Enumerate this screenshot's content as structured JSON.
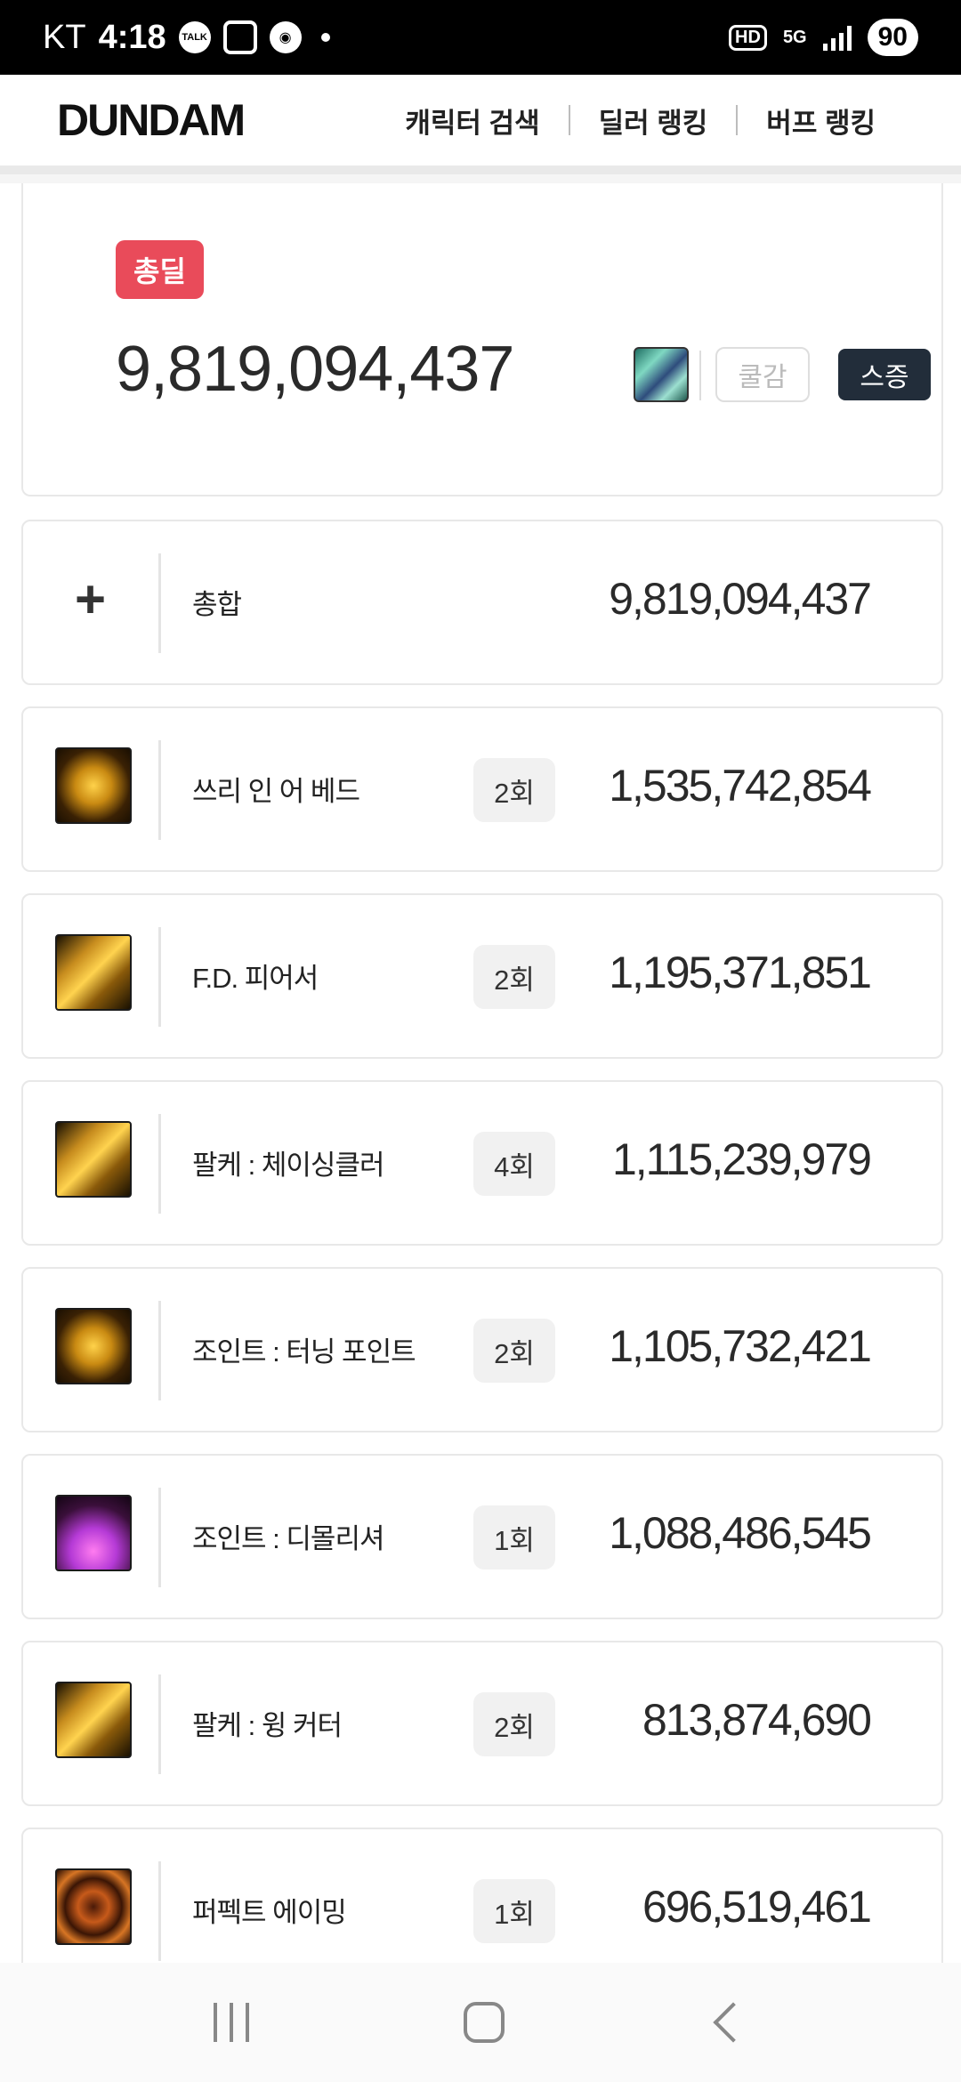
{
  "status_bar": {
    "carrier": "KT",
    "time": "4:18",
    "icon_talk": "TALK",
    "icon_2": "앱",
    "network": "5G",
    "hd": "HD",
    "battery": "90"
  },
  "header": {
    "logo": "DUNDAM",
    "nav": [
      "캐릭터 검색",
      "딜러 랭킹",
      "버프 랭킹"
    ]
  },
  "total_card": {
    "badge": "총딜",
    "value": "9,819,094,437",
    "cooldown_button": "쿨감",
    "stack_button": "스증",
    "colors": {
      "badge": "#e94b5a",
      "stack_button": "#222d3a"
    }
  },
  "summary_row": {
    "icon": "plus-icon",
    "label": "총합",
    "value": "9,819,094,437"
  },
  "skills": [
    {
      "name": "쓰리 인 어 베드",
      "count": "2회",
      "damage": "1,535,742,854",
      "icon": "three-in-a-bed-icon"
    },
    {
      "name": "F.D. 피어서",
      "count": "2회",
      "damage": "1,195,371,851",
      "icon": "fd-piercer-icon"
    },
    {
      "name": "팔케 : 체이싱클러",
      "count": "4회",
      "damage": "1,115,239,979",
      "icon": "chasing-icon"
    },
    {
      "name": "조인트 : 터닝 포인트",
      "count": "2회",
      "damage": "1,105,732,421",
      "icon": "turning-point-icon"
    },
    {
      "name": "조인트 : 디몰리셔",
      "count": "1회",
      "damage": "1,088,486,545",
      "icon": "demolisher-icon"
    },
    {
      "name": "팔케 : 윙 커터",
      "count": "2회",
      "damage": "813,874,690",
      "icon": "wing-cutter-icon"
    },
    {
      "name": "퍼펙트 에이밍",
      "count": "1회",
      "damage": "696,519,461",
      "icon": "perfect-aiming-icon"
    }
  ]
}
